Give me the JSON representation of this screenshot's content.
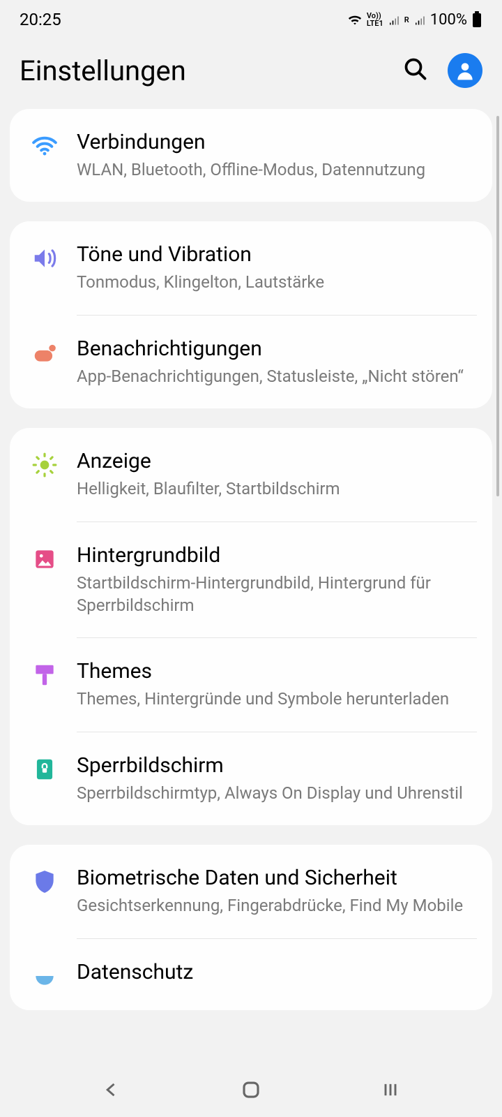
{
  "status": {
    "time": "20:25",
    "battery": "100%"
  },
  "header": {
    "title": "Einstellungen"
  },
  "groups": [
    {
      "items": [
        {
          "icon": "wifi",
          "color": "#3b9cff",
          "title": "Verbindungen",
          "subtitle": "WLAN, Bluetooth, Offline-Modus, Datennutzung"
        }
      ]
    },
    {
      "items": [
        {
          "icon": "sound",
          "color": "#7b7bea",
          "title": "Töne und Vibration",
          "subtitle": "Tonmodus, Klingelton, Lautstärke"
        },
        {
          "icon": "notification",
          "color": "#ed8268",
          "title": "Benachrichtigungen",
          "subtitle": "App-Benachrichtigungen, Statusleiste, „Nicht stören“"
        }
      ]
    },
    {
      "items": [
        {
          "icon": "display",
          "color": "#a6d13b",
          "title": "Anzeige",
          "subtitle": "Helligkeit, Blaufilter, Startbildschirm"
        },
        {
          "icon": "wallpaper",
          "color": "#e54d87",
          "title": "Hintergrundbild",
          "subtitle": "Startbildschirm-Hintergrundbild, Hintergrund für Sperrbildschirm"
        },
        {
          "icon": "themes",
          "color": "#c264e8",
          "title": "Themes",
          "subtitle": "Themes, Hintergründe und Symbole herunterladen"
        },
        {
          "icon": "lockscreen",
          "color": "#21b69a",
          "title": "Sperrbildschirm",
          "subtitle": "Sperrbildschirmtyp, Always On Display und Uhrenstil"
        }
      ]
    },
    {
      "items": [
        {
          "icon": "biometrics",
          "color": "#6b7ae8",
          "title": "Biometrische Daten und Sicherheit",
          "subtitle": "Gesichtserkennung, Fingerabdrücke, Find My Mobile"
        },
        {
          "icon": "privacy",
          "color": "#6bb5e8",
          "title": "Datenschutz",
          "subtitle": ""
        }
      ]
    }
  ]
}
